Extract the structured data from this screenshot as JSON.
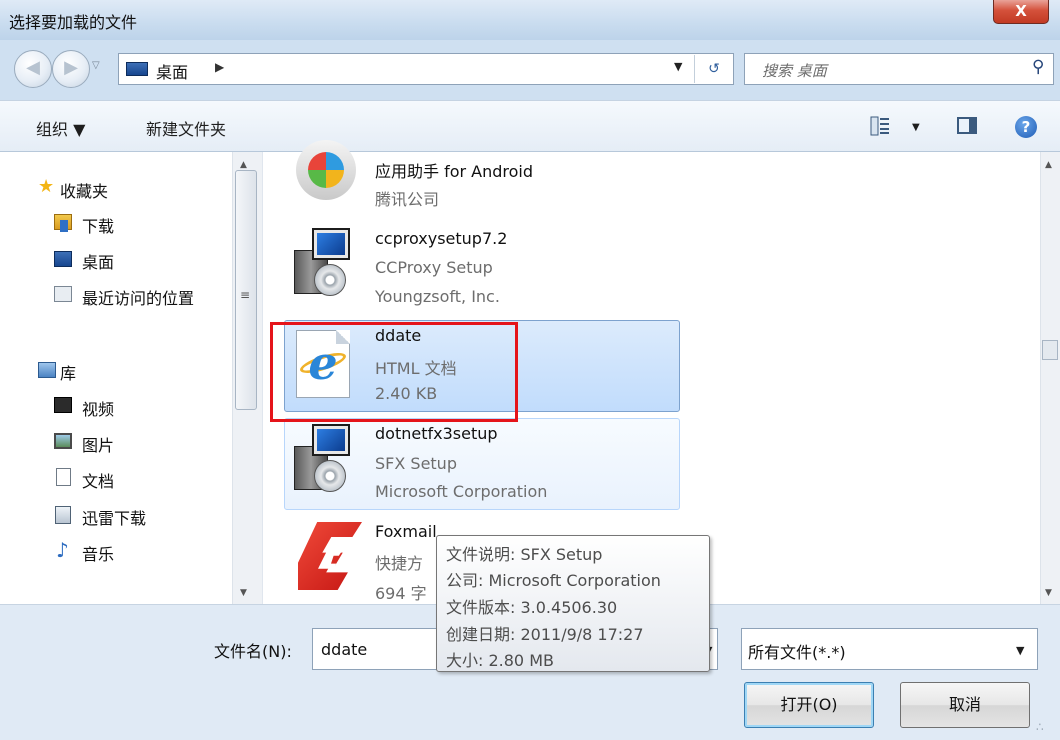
{
  "window": {
    "title": "选择要加载的文件",
    "close_label": "X"
  },
  "address": {
    "location": "桌面",
    "search_placeholder": "搜索 桌面"
  },
  "toolbar": {
    "organize": "组织 ▼",
    "new_folder": "新建文件夹"
  },
  "nav": {
    "favorites": "收藏夹",
    "downloads": "下载",
    "desktop": "桌面",
    "recent": "最近访问的位置",
    "libraries": "库",
    "videos": "视频",
    "pictures": "图片",
    "documents": "文档",
    "xunlei": "迅雷下载",
    "music": "音乐"
  },
  "files": [
    {
      "name": "应用助手 for Android",
      "line2": "腾讯公司",
      "line3": "",
      "icon": "android-assistant-icon"
    },
    {
      "name": "ccproxysetup7.2",
      "line2": "CCProxy Setup",
      "line3": "Youngzsoft, Inc.",
      "icon": "installer-icon"
    },
    {
      "name": "ddate",
      "line2": "HTML 文档",
      "line3": "2.40 KB",
      "icon": "html-document-icon",
      "selected": true
    },
    {
      "name": "dotnetfx3setup",
      "line2": "SFX Setup",
      "line3": "Microsoft Corporation",
      "icon": "installer-icon",
      "hovered": true
    },
    {
      "name": "Foxmail",
      "line2": "快捷方",
      "line3": "694 字",
      "icon": "foxmail-icon"
    }
  ],
  "tooltip": {
    "description": "文件说明: SFX Setup",
    "company": "公司: Microsoft Corporation",
    "version": "文件版本: 3.0.4506.30",
    "created": "创建日期: 2011/9/8 17:27",
    "size": "大小: 2.80 MB"
  },
  "bottom": {
    "filename_label": "文件名(N):",
    "filename_value": "ddate",
    "filetype_value": "所有文件(*.*)",
    "open_label": "打开(O)",
    "cancel_label": "取消"
  },
  "colors": {
    "highlight_border": "#e5141a",
    "selection_fill": "#c1dcfc",
    "window_chrome": "#cfe0f1"
  }
}
